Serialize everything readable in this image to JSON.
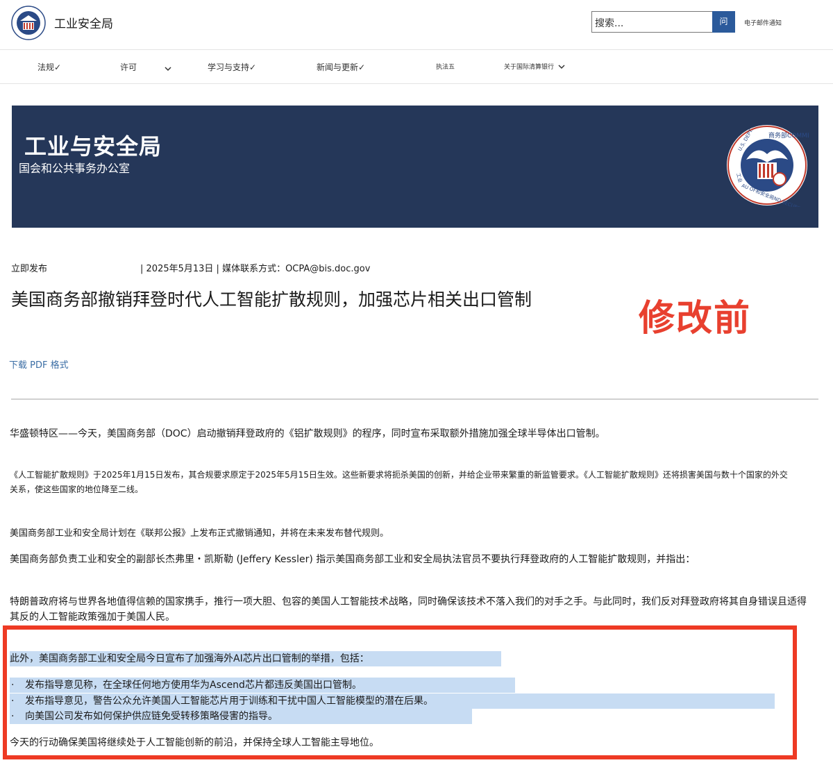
{
  "header": {
    "site_name": "工业安全局",
    "search_placeholder": "搜索...",
    "search_button": "问",
    "email_link": "电子邮件通知"
  },
  "nav": {
    "items": [
      {
        "label": "法规✓"
      },
      {
        "label": "许可"
      },
      {
        "label": "学习与支持✓"
      },
      {
        "label": "新闻与更新✓"
      },
      {
        "label": "执法五"
      },
      {
        "label": "关于国际清算银行"
      }
    ]
  },
  "banner": {
    "title": "工业与安全局",
    "subtitle": "国会和公共事务办公室",
    "seal_top_text": "商务部COMMERCE",
    "seal_bottom_text": "AU OF和安全局ND SECURITY",
    "seal_left_text": "U.S. DEPT.",
    "seal_side_text": "工业"
  },
  "article": {
    "release": "立即发布",
    "date_contact": "| 2025年5月13日 | 媒体联系方式：OCPA@bis.doc.gov",
    "headline": "美国商务部撤销拜登时代人工智能扩散规则，加强芯片相关出口管制",
    "stamp": "修改前",
    "pdf_link": "下载 PDF 格式",
    "p1": "华盛顿特区——今天，美国商务部（DOC）启动撤销拜登政府的《铝扩散规则》的程序，同时宣布采取额外措施加强全球半导体出口管制。",
    "p2": "《人工智能扩散规则》于2025年1月15日发布，其合规要求原定于2025年5月15日生效。这些新要求将扼杀美国的创新，并给企业带来繁重的新监管要求。《人工智能扩散规则》还将损害美国与数十个国家的外交关系，使这些国家的地位降至二线。",
    "p3": "美国商务部工业和安全局计划在《联邦公报》上发布正式撤销通知，并将在未来发布替代规则。",
    "p4": "美国商务部负责工业和安全的副部长杰弗里・凯斯勒 (Jeffery Kessler) 指示美国商务部工业和安全局执法官员不要执行拜登政府的人工智能扩散规则，并指出：",
    "p5": "特朗普政府将与世界各地值得信赖的国家携手，推行一项大胆、包容的美国人工智能技术战略，同时确保该技术不落入我们的对手之手。与此同时，我们反对拜登政府将其自身错误且适得其反的人工智能政策强加于美国人民。",
    "highlight_intro": "此外，美国商务部工业和安全局今日宣布了加强海外AI芯片出口管制的举措，包括：",
    "bullets": [
      {
        "dot": "·",
        "text": "发布指导意见称，在全球任何地方使用华为Ascend芯片都违反美国出口管制。"
      },
      {
        "dot": "·",
        "text": "发布指导意见，警告公众允许美国人工智能芯片用于训练和干扰中国人工智能模型的潜在后果。"
      },
      {
        "dot": "·",
        "text": "向美国公司发布如何保护供应链免受转移策略侵害的指导。"
      }
    ],
    "closing": "今天的行动确保美国将继续处于人工智能创新的前沿，并保持全球人工智能主导地位。"
  },
  "colors": {
    "banner_bg": "#253759",
    "accent_blue": "#2b5a9b",
    "highlight": "#c7dcf3",
    "red_box": "#ee3a24",
    "stamp_red": "#e8402f",
    "link_blue": "#3b6ea5"
  }
}
